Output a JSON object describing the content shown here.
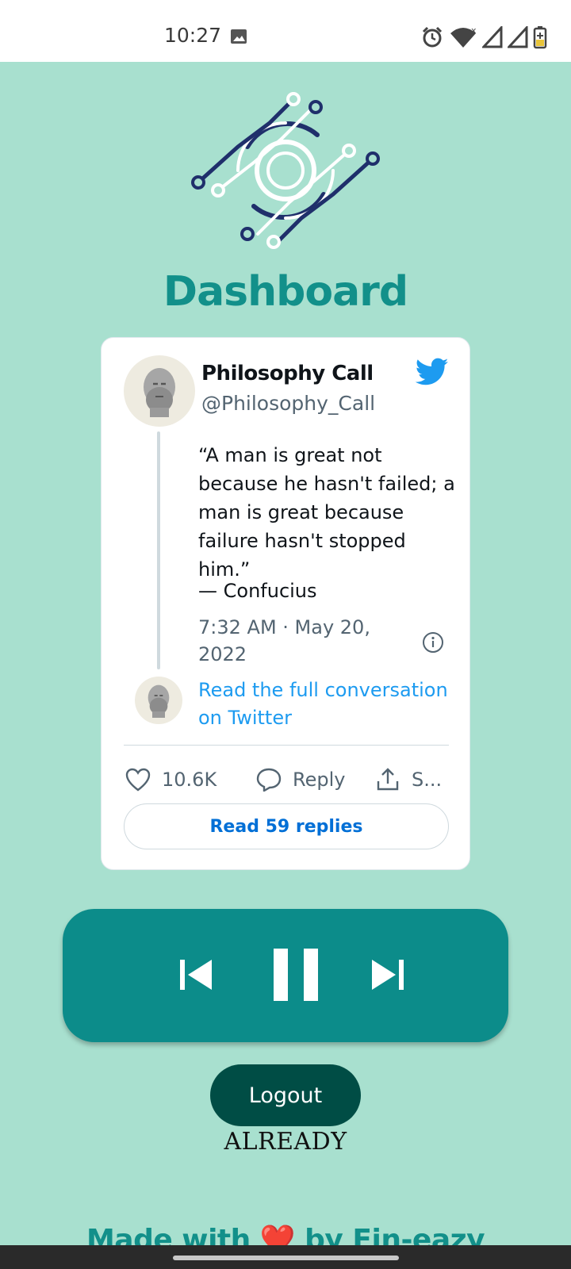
{
  "status_bar": {
    "time": "10:27",
    "icons": [
      "image-icon",
      "alarm-icon",
      "wifi-icon",
      "signal-icon",
      "signal-icon",
      "battery-icon"
    ]
  },
  "page": {
    "title": "Dashboard"
  },
  "tweet": {
    "author_name": "Philosophy Call",
    "author_handle": "@Philosophy_Call",
    "text": "“A man is great not because he hasn't failed; a man is great because failure hasn't stopped him.”",
    "attribution": "— Confucius",
    "timestamp": "7:32 AM · May 20, 2022",
    "read_conversation": "Read the full conversation on Twitter",
    "likes": "10.6K",
    "reply_label": "Reply",
    "share_label": "S...",
    "read_replies": "Read 59 replies"
  },
  "player": {
    "prev_icon": "skip-previous-icon",
    "pause_icon": "pause-icon",
    "next_icon": "skip-next-icon"
  },
  "logout_label": "Logout",
  "already_text": "ALREADY",
  "footer_text": "Made with ❤️ by Fin-eazy",
  "colors": {
    "background": "#a8e0cf",
    "accent": "#12908a",
    "player": "#0c8c8a",
    "logout": "#004d45",
    "twitter_blue": "#1d9bf0"
  }
}
